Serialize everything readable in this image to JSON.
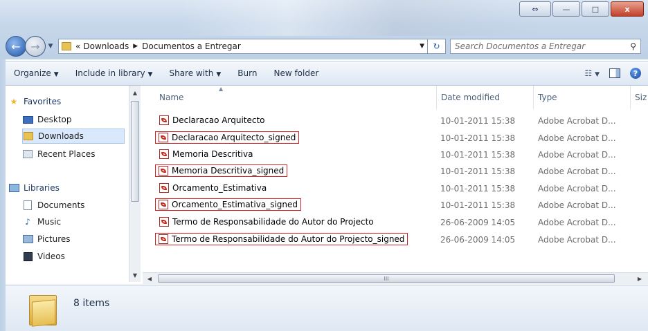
{
  "window": {
    "controls": {
      "resize": "⇔",
      "minimize": "—",
      "maximize": "□",
      "close": "x"
    }
  },
  "address": {
    "overflow": "«",
    "segments": [
      "Downloads",
      "Documentos a Entregar"
    ],
    "separator": "▶",
    "search_placeholder": "Search Documentos a Entregar"
  },
  "toolbar": {
    "organize": "Organize",
    "include_in_library": "Include in library",
    "share_with": "Share with",
    "burn": "Burn",
    "new_folder": "New folder"
  },
  "nav": {
    "favorites_label": "Favorites",
    "favorites": [
      "Desktop",
      "Downloads",
      "Recent Places"
    ],
    "libraries_label": "Libraries",
    "libraries": [
      "Documents",
      "Music",
      "Pictures",
      "Videos"
    ],
    "selected": "Downloads"
  },
  "columns": {
    "name": "Name",
    "date": "Date modified",
    "type": "Type",
    "size": "Siz"
  },
  "files": [
    {
      "name": "Declaracao Arquitecto",
      "date": "10-01-2011 15:38",
      "type": "Adobe Acrobat D...",
      "highlighted": false
    },
    {
      "name": "Declaracao Arquitecto_signed",
      "date": "10-01-2011 15:38",
      "type": "Adobe Acrobat D...",
      "highlighted": true
    },
    {
      "name": "Memoria Descritiva",
      "date": "10-01-2011 15:38",
      "type": "Adobe Acrobat D...",
      "highlighted": false
    },
    {
      "name": "Memoria Descritiva_signed",
      "date": "10-01-2011 15:38",
      "type": "Adobe Acrobat D...",
      "highlighted": true
    },
    {
      "name": "Orcamento_Estimativa",
      "date": "10-01-2011 15:38",
      "type": "Adobe Acrobat D...",
      "highlighted": false
    },
    {
      "name": "Orcamento_Estimativa_signed",
      "date": "10-01-2011 15:38",
      "type": "Adobe Acrobat D...",
      "highlighted": true
    },
    {
      "name": "Termo de Responsabilidade do Autor do Projecto",
      "date": "26-06-2009 14:05",
      "type": "Adobe Acrobat D...",
      "highlighted": false
    },
    {
      "name": "Termo de Responsabilidade do Autor do Projecto_signed",
      "date": "26-06-2009 14:05",
      "type": "Adobe Acrobat D...",
      "highlighted": true
    }
  ],
  "status": {
    "item_count": "8 items"
  },
  "colors": {
    "highlight_border": "#d42020",
    "selected_bg": "#d9e8fb"
  }
}
